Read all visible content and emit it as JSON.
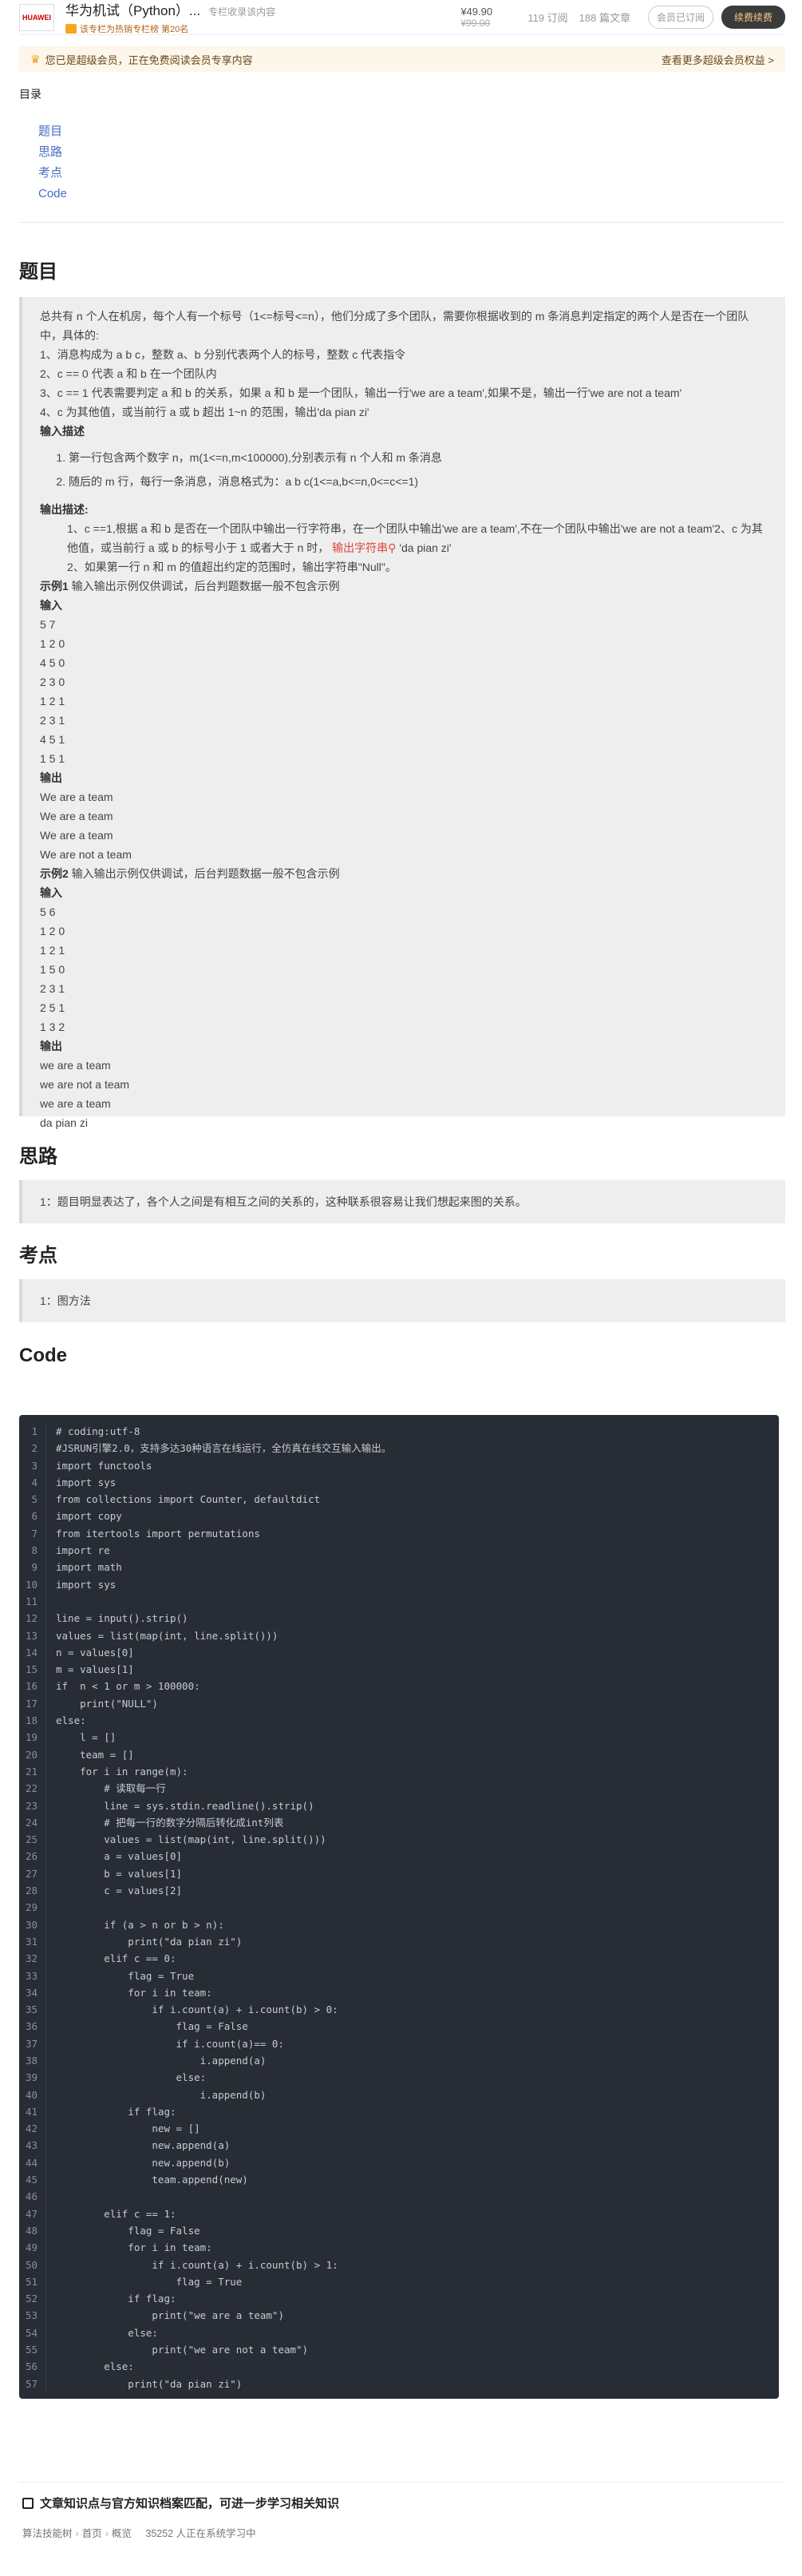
{
  "column": {
    "thumb_label": "HUAWEI",
    "title": "华为机试（Python）...",
    "subtitle": "专栏收录该内容",
    "badge": "该专栏为热销专栏榜 第20名",
    "price": "¥49.90",
    "original_price": "¥99.00",
    "subscriptions": "119 订阅",
    "articles": "188 篇文章",
    "subscribed_button": "会员已订阅",
    "renew_button": "续费续费"
  },
  "vip_banner": {
    "text": "您已是超级会员，正在免费阅读会员专享内容",
    "more_link": "查看更多超级会员权益 >"
  },
  "toc": {
    "heading": "目录",
    "items": [
      "题目",
      "思路",
      "考点",
      "Code"
    ]
  },
  "sections": {
    "problem": "题目",
    "idea": "思路",
    "point": "考点",
    "code": "Code"
  },
  "problem": {
    "intro1": "总共有 n 个人在机房，每个人有一个标号（1<=标号<=n），他们分成了多个团队，需要你根据收到的 m 条消息判定指定的两个人是否在一个团队中，具体的:",
    "rule1": "1、消息构成为 a b c，整数 a、b 分别代表两个人的标号，整数 c 代表指令",
    "rule2": "2、c == 0 代表 a 和 b 在一个团队内",
    "rule3": "3、c == 1 代表需要判定 a 和 b 的关系，如果 a 和 b 是一个团队，输出一行'we are a team',如果不是，输出一行'we are not a team'",
    "rule4": "4、c 为其他值，或当前行 a 或 b 超出 1~n 的范围，输出'da pian zi'",
    "input_desc_label": "输入描述",
    "input_items": [
      "第一行包含两个数字 n，m(1<=n,m<100000),分别表示有 n 个人和 m 条消息",
      "随后的 m 行，每行一条消息，消息格式为：a b c(1<=a,b<=n,0<=c<=1)"
    ],
    "output_desc_label": "输出描述:",
    "output1_a": "1、c ==1,根据 a 和 b 是否在一个团队中输出一行字符串，在一个团队中输出'we are a team',不在一个团队中输出'we are not a team'2、c 为其他值，或当前行 a 或 b 的标号小于 1 或者大于 n 时，",
    "output1_link": "输出字符串",
    "output1_b": "'da pian zi'",
    "output2": "2、如果第一行 n 和 m 的值超出约定的范围时，输出字符串\"Null\"。",
    "example1_label": "示例1",
    "example_note": "输入输出示例仅供调试，后台判题数据一般不包含示例",
    "input_label": "输入",
    "output_label": "输出",
    "example1_input": [
      "5 7",
      "1 2 0",
      "4 5 0",
      "2 3 0",
      "1 2 1",
      "2 3 1",
      "4 5 1",
      "1 5 1"
    ],
    "example1_output": [
      "We are a team",
      "We are a team",
      "We are a team",
      "We are not a team"
    ],
    "example2_label": "示例2",
    "example2_input": [
      "5 6",
      "1 2 0",
      "1 2 1",
      "1 5 0",
      "2 3 1",
      "2 5 1",
      "1 3 2"
    ],
    "example2_output": [
      "we are a team",
      "we are not a team",
      "we are a team",
      "da pian zi"
    ]
  },
  "idea_text": "1：题目明显表达了，各个人之间是有相互之间的关系的，这种联系很容易让我们想起来图的关系。",
  "point_text": "1：图方法",
  "code_lines": [
    "# coding:utf-8",
    "#JSRUN引擎2.0，支持多达30种语言在线运行，全仿真在线交互输入输出。",
    "import functools",
    "import sys",
    "from collections import Counter, defaultdict",
    "import copy",
    "from itertools import permutations",
    "import re",
    "import math",
    "import sys",
    "",
    "line = input().strip()",
    "values = list(map(int, line.split()))",
    "n = values[0]",
    "m = values[1]",
    "if  n < 1 or m > 100000:",
    "    print(\"NULL\")",
    "else:",
    "    l = []",
    "    team = []",
    "    for i in range(m):",
    "        # 读取每一行",
    "        line = sys.stdin.readline().strip()",
    "        # 把每一行的数字分隔后转化成int列表",
    "        values = list(map(int, line.split()))",
    "        a = values[0]",
    "        b = values[1]",
    "        c = values[2]",
    "",
    "        if (a > n or b > n):",
    "            print(\"da pian zi\")",
    "        elif c == 0:",
    "            flag = True",
    "            for i in team:",
    "                if i.count(a) + i.count(b) > 0:",
    "                    flag = False",
    "                    if i.count(a)== 0:",
    "                        i.append(a)",
    "                    else:",
    "                        i.append(b)",
    "            if flag:",
    "                new = []",
    "                new.append(a)",
    "                new.append(b)",
    "                team.append(new)",
    "",
    "        elif c == 1:",
    "            flag = False",
    "            for i in team:",
    "                if i.count(a) + i.count(b) > 1:",
    "                    flag = True",
    "            if flag:",
    "                print(\"we are a team\")",
    "            else:",
    "                print(\"we are not a team\")",
    "        else:",
    "            print(\"da pian zi\")"
  ],
  "footer": {
    "title": "文章知识点与官方知识档案匹配，可进一步学习相关知识",
    "path": [
      "算法技能树",
      "首页",
      "概览"
    ],
    "learners": "35252 人正在系统学习中"
  },
  "colors": {
    "link": "#4a6cc7",
    "code_bg": "#282c34",
    "vip_bg": "#fdf6ea",
    "note_bg": "#eeeeef"
  }
}
